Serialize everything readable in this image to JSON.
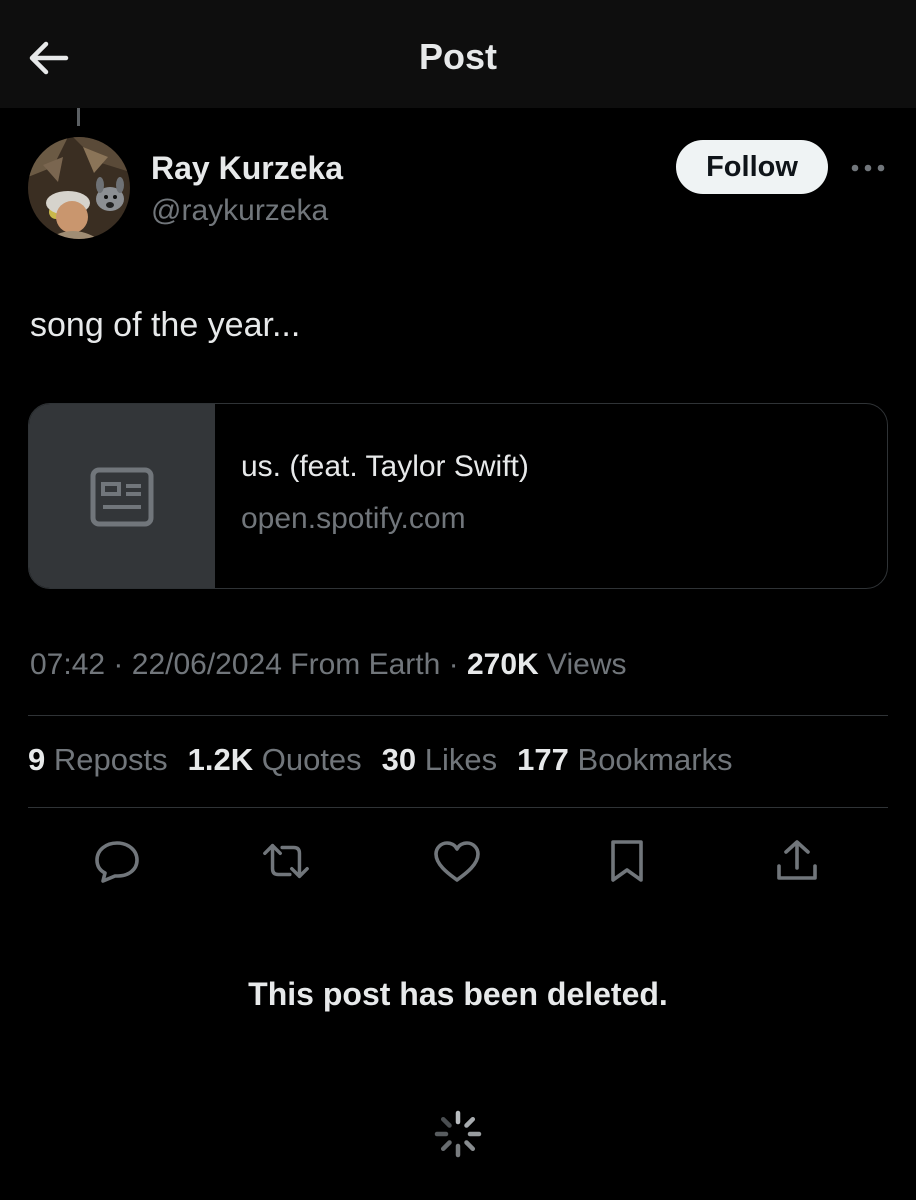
{
  "header": {
    "title": "Post",
    "back_icon": "arrow-left-icon"
  },
  "author": {
    "name": "Ray Kurzeka",
    "handle": "@raykurzeka",
    "follow_label": "Follow"
  },
  "post": {
    "text": "song of the year...",
    "link_card": {
      "title": "us. (feat. Taylor Swift)",
      "domain": "open.spotify.com"
    }
  },
  "meta": {
    "time": "07:42",
    "date": "22/06/2024",
    "source": "From Earth",
    "views_count": "270K",
    "views_label": "Views"
  },
  "stats": [
    {
      "count": "9",
      "label": "Reposts"
    },
    {
      "count": "1.2K",
      "label": "Quotes"
    },
    {
      "count": "30",
      "label": "Likes"
    },
    {
      "count": "177",
      "label": "Bookmarks"
    }
  ],
  "actions": [
    "reply-icon",
    "repost-icon",
    "like-icon",
    "bookmark-icon",
    "share-icon"
  ],
  "deleted_message": "This post has been deleted.",
  "colors": {
    "background": "#000000",
    "header": "#0e0e0e",
    "text": "#e7e9ea",
    "muted": "#71767b",
    "border": "#2f3336"
  }
}
